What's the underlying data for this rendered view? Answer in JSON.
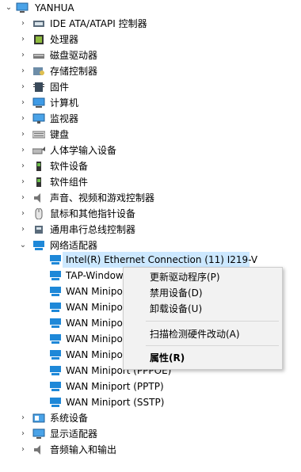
{
  "root": {
    "label": "YANHUA",
    "expanded": true
  },
  "categories": [
    {
      "label": "IDE ATA/ATAPI 控制器",
      "icon": "ide-controller-icon"
    },
    {
      "label": "处理器",
      "icon": "processor-icon"
    },
    {
      "label": "磁盘驱动器",
      "icon": "disk-drive-icon"
    },
    {
      "label": "存储控制器",
      "icon": "storage-controller-icon"
    },
    {
      "label": "固件",
      "icon": "firmware-icon"
    },
    {
      "label": "计算机",
      "icon": "computer-icon"
    },
    {
      "label": "监视器",
      "icon": "monitor-icon"
    },
    {
      "label": "键盘",
      "icon": "keyboard-icon"
    },
    {
      "label": "人体学输入设备",
      "icon": "hid-icon"
    },
    {
      "label": "软件设备",
      "icon": "software-device-icon"
    },
    {
      "label": "软件组件",
      "icon": "software-component-icon"
    },
    {
      "label": "声音、视频和游戏控制器",
      "icon": "audio-icon"
    },
    {
      "label": "鼠标和其他指针设备",
      "icon": "mouse-icon"
    },
    {
      "label": "通用串行总线控制器",
      "icon": "usb-icon"
    }
  ],
  "network": {
    "label": "网络适配器",
    "children": [
      "Intel(R) Ethernet Connection (11) I219-V",
      "TAP-Windows Adapter V9",
      "WAN Miniport (IKEv2)",
      "WAN Miniport (IP)",
      "WAN Miniport (IPv6)",
      "WAN Miniport (L2TP)",
      "WAN Miniport (Network Monitor)",
      "WAN Miniport (PPPOE)",
      "WAN Miniport (PPTP)",
      "WAN Miniport (SSTP)"
    ]
  },
  "after_categories": [
    {
      "label": "系统设备",
      "icon": "system-device-icon"
    },
    {
      "label": "显示适配器",
      "icon": "display-adapter-icon"
    },
    {
      "label": "音频输入和输出",
      "icon": "audio-io-icon"
    }
  ],
  "context_menu": {
    "update_driver": "更新驱动程序(P)",
    "disable_device": "禁用设备(D)",
    "uninstall_device": "卸载设备(U)",
    "scan_hardware": "扫描检测硬件改动(A)",
    "properties": "属性(R)"
  },
  "colors": {
    "selection": "#cce8ff",
    "menu_bg": "#f2f2f2",
    "net_icon": "#1e88d8"
  }
}
